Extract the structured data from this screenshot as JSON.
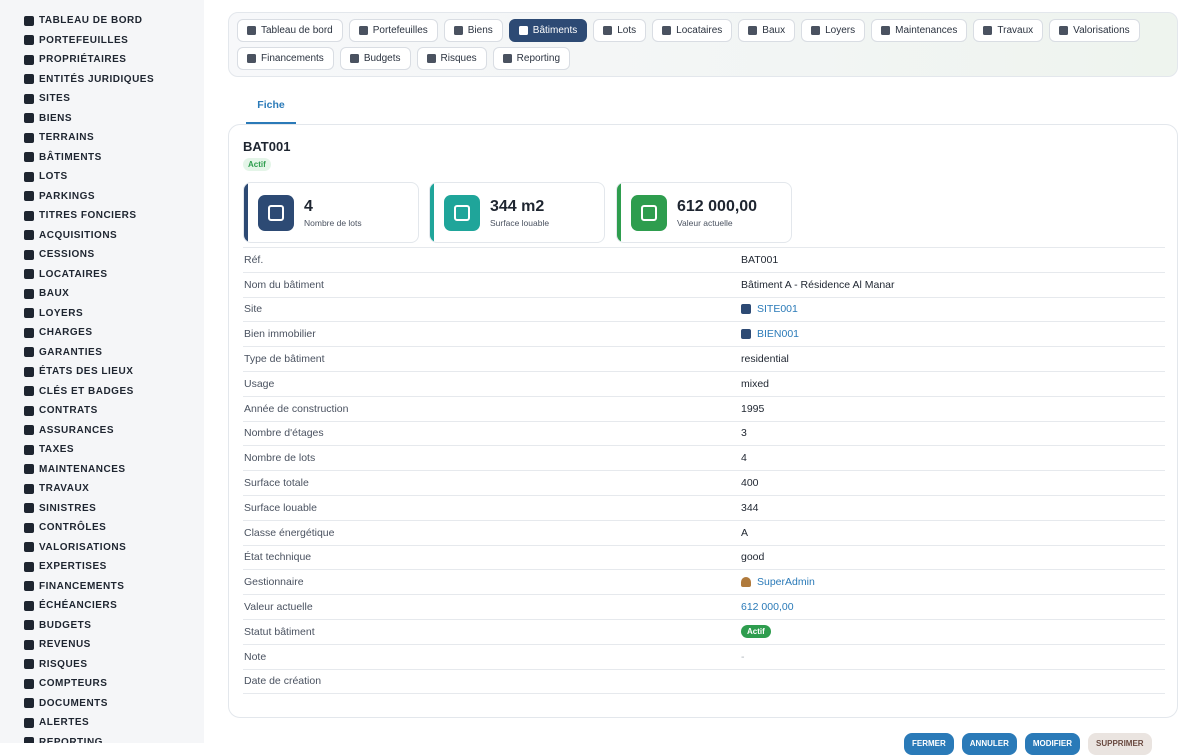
{
  "sidebar": {
    "items": [
      {
        "label": "TABLEAU DE BORD",
        "icon": "gauge-icon"
      },
      {
        "label": "PORTEFEUILLES",
        "icon": "briefcase-icon"
      },
      {
        "label": "PROPRIÉTAIRES",
        "icon": "user-tie-icon"
      },
      {
        "label": "ENTITÉS JURIDIQUES",
        "icon": "bank-icon"
      },
      {
        "label": "SITES",
        "icon": "city-icon"
      },
      {
        "label": "BIENS",
        "icon": "building-icon"
      },
      {
        "label": "TERRAINS",
        "icon": "map-frame-icon"
      },
      {
        "label": "BÂTIMENTS",
        "icon": "buildings-icon"
      },
      {
        "label": "LOTS",
        "icon": "grid-icon"
      },
      {
        "label": "PARKINGS",
        "icon": "parking-icon"
      },
      {
        "label": "TITRES FONCIERS",
        "icon": "file-signature-icon"
      },
      {
        "label": "ACQUISITIONS",
        "icon": "handshake-icon"
      },
      {
        "label": "CESSIONS",
        "icon": "exit-icon"
      },
      {
        "label": "LOCATAIRES",
        "icon": "users-icon"
      },
      {
        "label": "BAUX",
        "icon": "file-icon"
      },
      {
        "label": "LOYERS",
        "icon": "invoice-icon"
      },
      {
        "label": "CHARGES",
        "icon": "receipt-icon"
      },
      {
        "label": "GARANTIES",
        "icon": "shield-icon"
      },
      {
        "label": "ÉTATS DES LIEUX",
        "icon": "clipboard-check-icon"
      },
      {
        "label": "CLÉS ET BADGES",
        "icon": "key-icon"
      },
      {
        "label": "CONTRATS",
        "icon": "file-contract-icon"
      },
      {
        "label": "ASSURANCES",
        "icon": "umbrella-icon"
      },
      {
        "label": "TAXES",
        "icon": "percent-icon"
      },
      {
        "label": "MAINTENANCES",
        "icon": "tools-icon"
      },
      {
        "label": "TRAVAUX",
        "icon": "hard-hat-icon"
      },
      {
        "label": "SINISTRES",
        "icon": "warning-icon"
      },
      {
        "label": "CONTRÔLES",
        "icon": "clipboard-list-icon"
      },
      {
        "label": "VALORISATIONS",
        "icon": "scale-icon"
      },
      {
        "label": "EXPERTISES",
        "icon": "gavel-icon"
      },
      {
        "label": "FINANCEMENTS",
        "icon": "bank-icon"
      },
      {
        "label": "ÉCHÉANCIERS",
        "icon": "calendar-icon"
      },
      {
        "label": "BUDGETS",
        "icon": "wallet-icon"
      },
      {
        "label": "REVENUS",
        "icon": "money-bill-icon"
      },
      {
        "label": "RISQUES",
        "icon": "exclamation-circle-icon"
      },
      {
        "label": "COMPTEURS",
        "icon": "gauge-icon"
      },
      {
        "label": "DOCUMENTS",
        "icon": "folder-icon"
      },
      {
        "label": "ALERTES",
        "icon": "bell-icon"
      },
      {
        "label": "REPORTING",
        "icon": "chart-pie-icon"
      }
    ]
  },
  "tabs": [
    {
      "label": "Tableau de bord",
      "icon": "gauge-icon",
      "active": false
    },
    {
      "label": "Portefeuilles",
      "icon": "briefcase-icon",
      "active": false
    },
    {
      "label": "Biens",
      "icon": "building-icon",
      "active": false
    },
    {
      "label": "Bâtiments",
      "icon": "buildings-icon",
      "active": true
    },
    {
      "label": "Lots",
      "icon": "grid-icon",
      "active": false
    },
    {
      "label": "Locataires",
      "icon": "users-icon",
      "active": false
    },
    {
      "label": "Baux",
      "icon": "file-icon",
      "active": false
    },
    {
      "label": "Loyers",
      "icon": "invoice-icon",
      "active": false
    },
    {
      "label": "Maintenances",
      "icon": "tools-icon",
      "active": false
    },
    {
      "label": "Travaux",
      "icon": "hard-hat-icon",
      "active": false
    },
    {
      "label": "Valorisations",
      "icon": "scale-icon",
      "active": false
    },
    {
      "label": "Financements",
      "icon": "bank-icon",
      "active": false
    },
    {
      "label": "Budgets",
      "icon": "wallet-icon",
      "active": false
    },
    {
      "label": "Risques",
      "icon": "exclamation-circle-icon",
      "active": false
    },
    {
      "label": "Reporting",
      "icon": "chart-pie-icon",
      "active": false
    }
  ],
  "subtab": {
    "label": "Fiche"
  },
  "record": {
    "title": "BAT001",
    "status_badge": "Actif"
  },
  "stats": [
    {
      "value": "4",
      "label": "Nombre de lots",
      "icon": "grid-icon",
      "color": "#2d4a74"
    },
    {
      "value": "344 m2",
      "label": "Surface louable",
      "icon": "ruler-icon",
      "color": "#1fa59a"
    },
    {
      "value": "612 000,00",
      "label": "Valeur actuelle",
      "icon": "coins-icon",
      "color": "#2e9d4e"
    }
  ],
  "fields": [
    {
      "key": "Réf.",
      "value": "BAT001",
      "type": "text"
    },
    {
      "key": "Nom du bâtiment",
      "value": "Bâtiment A - Résidence Al Manar",
      "type": "text"
    },
    {
      "key": "Site",
      "value": "SITE001",
      "type": "link-icon"
    },
    {
      "key": "Bien immobilier",
      "value": "BIEN001",
      "type": "link-icon"
    },
    {
      "key": "Type de bâtiment",
      "value": "residential",
      "type": "text"
    },
    {
      "key": "Usage",
      "value": "mixed",
      "type": "text"
    },
    {
      "key": "Année de construction",
      "value": "1995",
      "type": "text"
    },
    {
      "key": "Nombre d'étages",
      "value": "3",
      "type": "text"
    },
    {
      "key": "Nombre de lots",
      "value": "4",
      "type": "text"
    },
    {
      "key": "Surface totale",
      "value": "400",
      "type": "text"
    },
    {
      "key": "Surface louable",
      "value": "344",
      "type": "text"
    },
    {
      "key": "Classe énergétique",
      "value": "A",
      "type": "text"
    },
    {
      "key": "État technique",
      "value": "good",
      "type": "text"
    },
    {
      "key": "Gestionnaire",
      "value": "SuperAdmin",
      "type": "user"
    },
    {
      "key": "Valeur actuelle",
      "value": "612 000,00",
      "type": "link"
    },
    {
      "key": "Statut bâtiment",
      "value": "Actif",
      "type": "badge"
    },
    {
      "key": "Note",
      "value": "-",
      "type": "muted"
    },
    {
      "key": "Date de création",
      "value": "",
      "type": "text"
    }
  ],
  "actions": [
    {
      "label": "FERMER",
      "style": "primary"
    },
    {
      "label": "ANNULER",
      "style": "primary"
    },
    {
      "label": "MODIFIER",
      "style": "primary"
    },
    {
      "label": "SUPPRIMER",
      "style": "danger"
    }
  ]
}
